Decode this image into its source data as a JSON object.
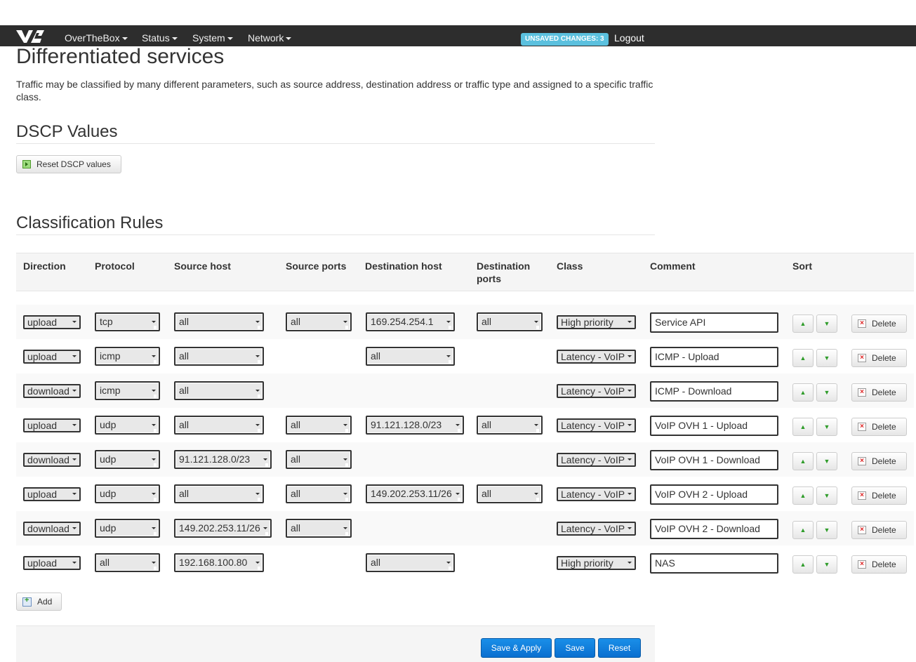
{
  "navbar": {
    "menu": [
      {
        "label": "OverTheBox"
      },
      {
        "label": "Status"
      },
      {
        "label": "System"
      },
      {
        "label": "Network"
      }
    ],
    "unsaved_label": "UNSAVED CHANGES: 3",
    "logout_label": "Logout"
  },
  "page": {
    "title": "Differentiated services",
    "description": "Traffic may be classified by many different parameters, such as source address, destination address or traffic type and assigned to a specific traffic class."
  },
  "dscp": {
    "title": "DSCP Values",
    "reset_label": "Reset DSCP values"
  },
  "rules": {
    "title": "Classification Rules",
    "headers": {
      "direction": "Direction",
      "protocol": "Protocol",
      "source_host": "Source host",
      "source_ports": "Source ports",
      "destination_host": "Destination host",
      "destination_ports": "Destination ports",
      "class": "Class",
      "comment": "Comment",
      "sort": "Sort"
    },
    "delete_label": "Delete",
    "add_label": "Add",
    "rows": [
      {
        "direction": "upload",
        "protocol": "tcp",
        "source_host": "all",
        "source_ports": "all",
        "destination_host": "169.254.254.1",
        "destination_ports": "all",
        "class": "High priority",
        "comment": "Service API"
      },
      {
        "direction": "upload",
        "protocol": "icmp",
        "source_host": "all",
        "source_ports": "",
        "destination_host": "all",
        "destination_ports": "",
        "class": "Latency - VoIP",
        "comment": "ICMP - Upload"
      },
      {
        "direction": "download",
        "protocol": "icmp",
        "source_host": "all",
        "source_ports": "",
        "destination_host": "",
        "destination_ports": "",
        "class": "Latency - VoIP",
        "comment": "ICMP - Download"
      },
      {
        "direction": "upload",
        "protocol": "udp",
        "source_host": "all",
        "source_ports": "all",
        "destination_host": "91.121.128.0/23",
        "destination_ports": "all",
        "class": "Latency - VoIP",
        "comment": "VoIP OVH 1 - Upload"
      },
      {
        "direction": "download",
        "protocol": "udp",
        "source_host": "91.121.128.0/23",
        "source_ports": "all",
        "destination_host": "",
        "destination_ports": "",
        "class": "Latency - VoIP",
        "comment": "VoIP OVH 1 - Download"
      },
      {
        "direction": "upload",
        "protocol": "udp",
        "source_host": "all",
        "source_ports": "all",
        "destination_host": "149.202.253.11/26",
        "destination_ports": "all",
        "class": "Latency - VoIP",
        "comment": "VoIP OVH 2 - Upload"
      },
      {
        "direction": "download",
        "protocol": "udp",
        "source_host": "149.202.253.11/26",
        "source_ports": "all",
        "destination_host": "",
        "destination_ports": "",
        "class": "Latency - VoIP",
        "comment": "VoIP OVH 2 - Download"
      },
      {
        "direction": "upload",
        "protocol": "all",
        "source_host": "192.168.100.80",
        "source_ports": "",
        "destination_host": "all",
        "destination_ports": "",
        "class": "High priority",
        "comment": "NAS"
      }
    ]
  },
  "footer": {
    "save_apply_label": "Save & Apply",
    "save_label": "Save",
    "reset_label": "Reset"
  }
}
